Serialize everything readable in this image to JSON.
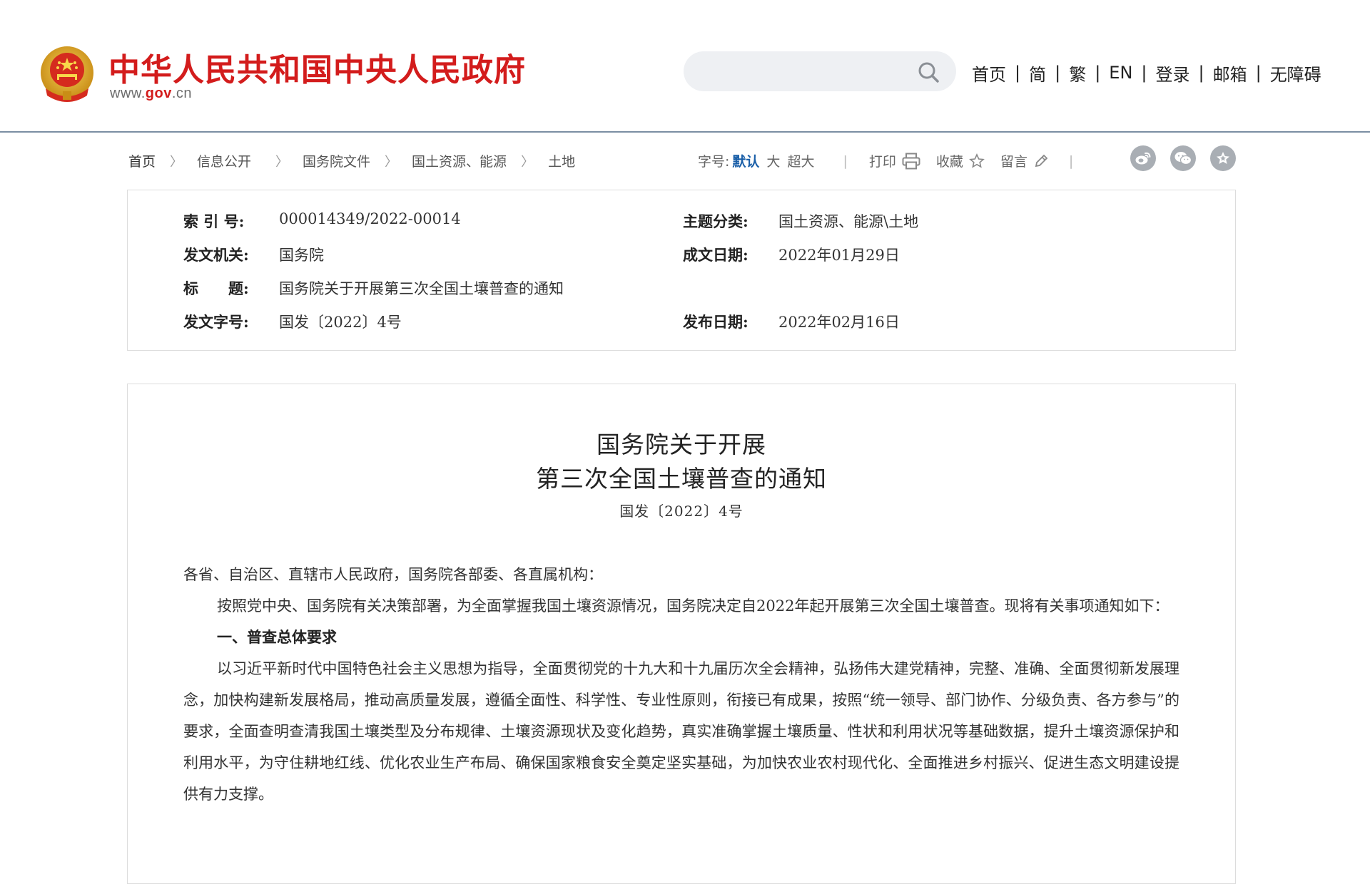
{
  "header": {
    "site_title": "中华人民共和国中央人民政府",
    "site_url_prefix": "www.",
    "site_url_domain": "gov",
    "site_url_suffix": ".cn",
    "search": {
      "value": "",
      "placeholder": ""
    },
    "nav": [
      "首页",
      "简",
      "繁",
      "EN",
      "登录",
      "邮箱",
      "无障碍"
    ],
    "nav_separator": "|"
  },
  "breadcrumb": [
    "首页",
    "信息公开",
    "国务院文件",
    "国土资源、能源",
    "土地"
  ],
  "toolbar": {
    "font_size_label": "字号:",
    "font_size_options": [
      "默认",
      "大",
      "超大"
    ],
    "print_label": "打印",
    "favorite_label": "收藏",
    "comment_label": "留言",
    "separator": "|"
  },
  "share_icons": [
    "weibo-icon",
    "wechat-icon",
    "favorites-icon"
  ],
  "info": {
    "index_no": {
      "label": "索 引 号:",
      "value": "000014349/2022-00014"
    },
    "subject": {
      "label": "主题分类:",
      "value": "国土资源、能源\\土地"
    },
    "issuer": {
      "label": "发文机关:",
      "value": "国务院"
    },
    "written_date": {
      "label": "成文日期:",
      "value": "2022年01月29日"
    },
    "title": {
      "label": "标　　题:",
      "value": "国务院关于开展第三次全国土壤普查的通知"
    },
    "doc_no": {
      "label": "发文字号:",
      "value": "国发〔2022〕4号"
    },
    "publish_date": {
      "label": "发布日期:",
      "value": "2022年02月16日"
    }
  },
  "article": {
    "title_line1": "国务院关于开展",
    "title_line2": "第三次全国土壤普查的通知",
    "doc_number": "国发〔2022〕4号",
    "salutation": "各省、自治区、直辖市人民政府，国务院各部委、各直属机构：",
    "paragraph1": "按照党中央、国务院有关决策部署，为全面掌握我国土壤资源情况，国务院决定自2022年起开展第三次全国土壤普查。现将有关事项通知如下：",
    "heading1": "一、普查总体要求",
    "paragraph2": "以习近平新时代中国特色社会主义思想为指导，全面贯彻党的十九大和十九届历次全会精神，弘扬伟大建党精神，完整、准确、全面贯彻新发展理念，加快构建新发展格局，推动高质量发展，遵循全面性、科学性、专业性原则，衔接已有成果，按照“统一领导、部门协作、分级负责、各方参与”的要求，全面查明查清我国土壤类型及分布规律、土壤资源现状及变化趋势，真实准确掌握土壤质量、性状和利用状况等基础数据，提升土壤资源保护和利用水平，为守住耕地红线、优化农业生产布局、确保国家粮食安全奠定坚实基础，为加快农业农村现代化、全面推进乡村振兴、促进生态文明建设提供有力支撑。"
  },
  "colors": {
    "brand_red": "#d31c1c",
    "emblem_gold": "#e8b22a",
    "link_blue": "#1a5fa8",
    "icon_gray": "#a9aeb4",
    "header_border": "#7b8ea3"
  }
}
